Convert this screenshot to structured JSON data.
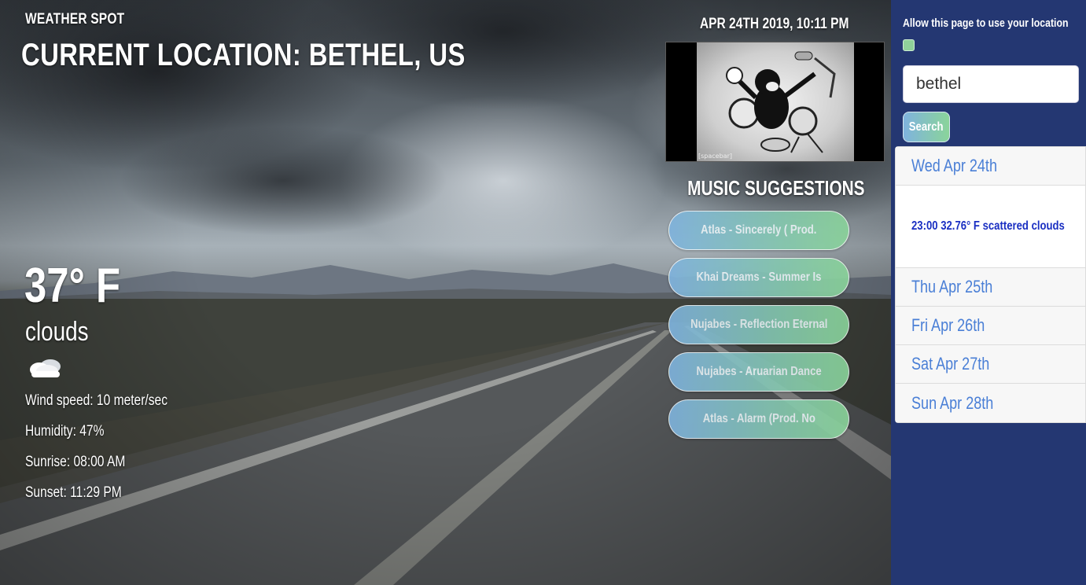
{
  "app": {
    "title": "WEATHER SPOT"
  },
  "location": {
    "label": "CURRENT LOCATION: BETHEL, US"
  },
  "current": {
    "temperature": "37° F",
    "condition": "clouds",
    "icon": "cloud-icon",
    "wind": "Wind speed: 10 meter/sec",
    "humidity": "Humidity: 47%",
    "sunrise": "Sunrise: 08:00 AM",
    "sunset": "Sunset: 11:29 PM"
  },
  "datetime": "APR 24TH 2019, 10:11 PM",
  "video": {
    "caption": "[spacebar]"
  },
  "music": {
    "title": "MUSIC SUGGESTIONS",
    "songs": [
      "Atlas - Sincerely ( Prod.",
      "Khai Dreams - Summer Is",
      "Nujabes - Reflection Eternal",
      "Nujabes - Aruarian Dance",
      "Atlas - Alarm (Prod. No"
    ]
  },
  "sidebar": {
    "location_permission": "Allow this page to use your location",
    "search_value": "bethel",
    "search_button": "Search"
  },
  "forecast": {
    "days": [
      "Wed Apr 24th",
      "Thu Apr 25th",
      "Fri Apr 26th",
      "Sat Apr 27th",
      "Sun Apr 28th"
    ],
    "hourly": "23:00 32.76° F scattered clouds"
  },
  "colors": {
    "sidebar_bg": "#243772",
    "forecast_day_text": "#4a7fd6",
    "forecast_detail_text": "#1a2fc2",
    "button_gradient_start": "#7fb3de",
    "button_gradient_end": "#8ad49a"
  }
}
